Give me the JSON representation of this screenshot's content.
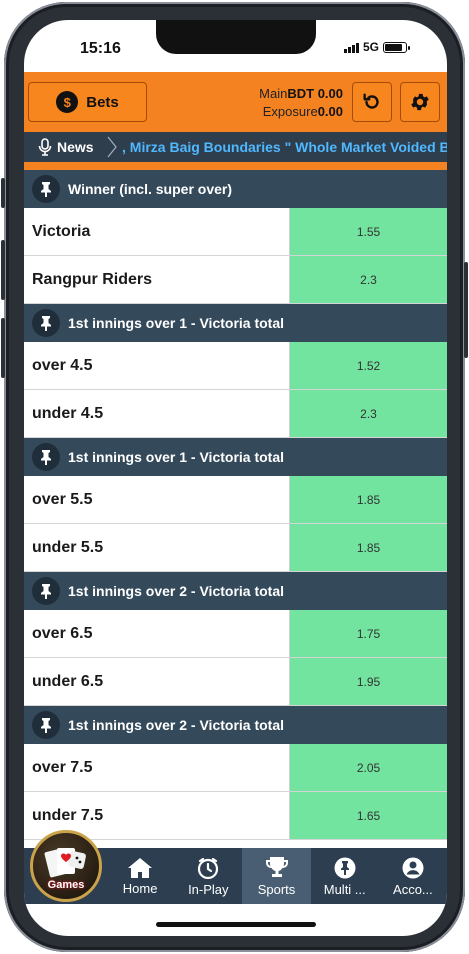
{
  "status_bar": {
    "time": "15:16",
    "network": "5G"
  },
  "header": {
    "bets_label": "Bets",
    "main_label": "Main",
    "main_value": "BDT 0.00",
    "exposure_label": "Exposure",
    "exposure_value": "0.00"
  },
  "news": {
    "label": "News",
    "ticker": ", Mirza Baig Boundaries \" Whole Market Voided Be"
  },
  "sections": [
    {
      "title": "Winner (incl. super over)",
      "rows": [
        {
          "name": "Victoria",
          "odds": "1.55"
        },
        {
          "name": "Rangpur Riders",
          "odds": "2.3"
        }
      ]
    },
    {
      "title": "1st innings over 1 - Victoria total",
      "rows": [
        {
          "name": "over 4.5",
          "odds": "1.52"
        },
        {
          "name": "under 4.5",
          "odds": "2.3"
        }
      ]
    },
    {
      "title": "1st innings over 1 - Victoria total",
      "rows": [
        {
          "name": "over 5.5",
          "odds": "1.85"
        },
        {
          "name": "under 5.5",
          "odds": "1.85"
        }
      ]
    },
    {
      "title": "1st innings over 2 - Victoria total",
      "rows": [
        {
          "name": "over 6.5",
          "odds": "1.75"
        },
        {
          "name": "under 6.5",
          "odds": "1.95"
        }
      ]
    },
    {
      "title": "1st innings over 2 - Victoria total",
      "rows": [
        {
          "name": "over 7.5",
          "odds": "2.05"
        },
        {
          "name": "under 7.5",
          "odds": "1.65"
        }
      ]
    }
  ],
  "nav": {
    "games_label": "Games",
    "home": "Home",
    "inplay": "In-Play",
    "sports": "Sports",
    "multi": "Multi ...",
    "account": "Acco..."
  },
  "colors": {
    "header_orange": "#f58220",
    "section_header": "#34495a",
    "odds_green": "#72e49f",
    "news_text": "#4fb8ff",
    "nav_bg": "#2c3e50"
  }
}
